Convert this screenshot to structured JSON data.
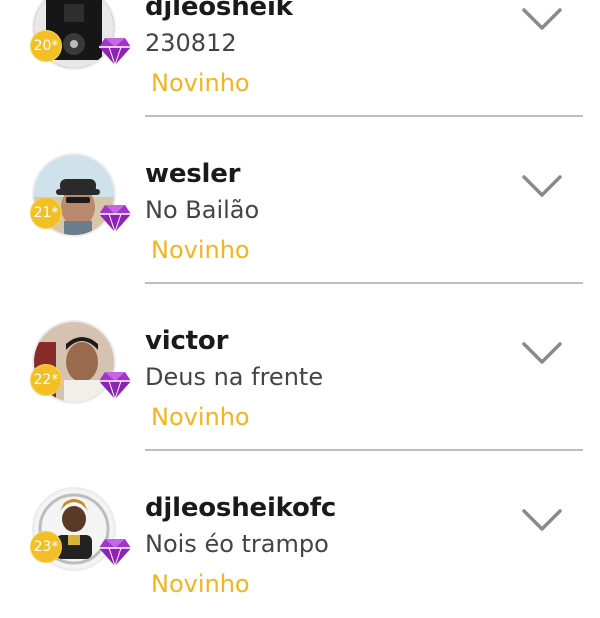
{
  "accent": {
    "rank_color": "#f3b41d",
    "badge_color": "#f2bf26",
    "gem_color": "#a235c9"
  },
  "icons": {
    "expand": "chevron-down-icon",
    "vip": "diamond-gem-icon"
  },
  "users": [
    {
      "name": "djleosheik",
      "status": "230812",
      "rank": "Novinho",
      "level": "20"
    },
    {
      "name": "wesler",
      "status": "No Bailão",
      "rank": "Novinho",
      "level": "21"
    },
    {
      "name": "victor",
      "status": "Deus na frente",
      "rank": "Novinho",
      "level": "22"
    },
    {
      "name": "djleosheikofc",
      "status": "Nois éo trampo",
      "rank": "Novinho",
      "level": "23"
    }
  ]
}
